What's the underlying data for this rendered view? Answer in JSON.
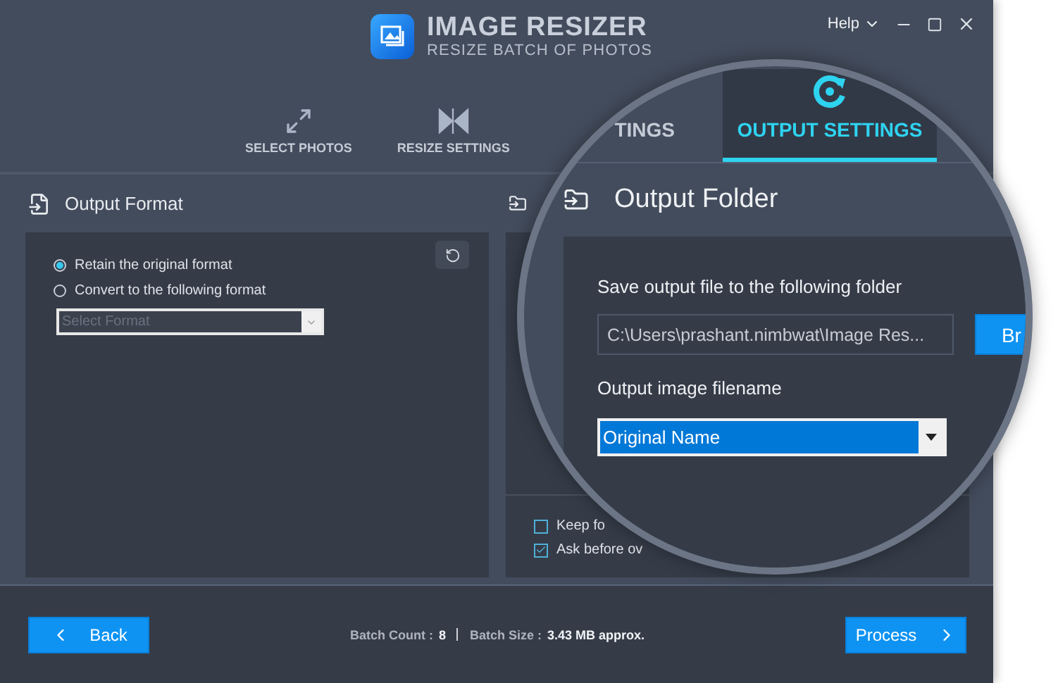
{
  "window": {
    "title": "IMAGE RESIZER",
    "subtitle": "RESIZE BATCH OF PHOTOS",
    "help": "Help"
  },
  "tabs": [
    {
      "label": "SELECT PHOTOS",
      "selected": false
    },
    {
      "label": "RESIZE SETTINGS",
      "selected": false
    }
  ],
  "output_format": {
    "title": "Output Format",
    "options": [
      {
        "label": "Retain the original format",
        "selected": true
      },
      {
        "label": "Convert to the following format",
        "selected": false
      }
    ],
    "format_select": {
      "placeholder": "Select Format"
    }
  },
  "output_folder_panel": {
    "checkboxes": [
      {
        "label": "Keep fo",
        "checked": false
      },
      {
        "label": "Ask before ov",
        "checked": true
      }
    ]
  },
  "magnifier": {
    "tabs": [
      {
        "label": "TINGS",
        "selected": false
      },
      {
        "label": "OUTPUT SETTINGS",
        "selected": true
      }
    ],
    "title": "Output Folder",
    "folder_label": "Save output file to the following folder",
    "folder_path": "C:\\Users\\prashant.nimbwat\\Image Res...",
    "browse": "Br",
    "filename_label": "Output image filename",
    "filename_value": "Original Name"
  },
  "footer": {
    "back": "Back",
    "batch_count_label": "Batch Count :",
    "batch_count": "8",
    "batch_size_label": "Batch Size :",
    "batch_size": "3.43 MB approx.",
    "process": "Process"
  }
}
